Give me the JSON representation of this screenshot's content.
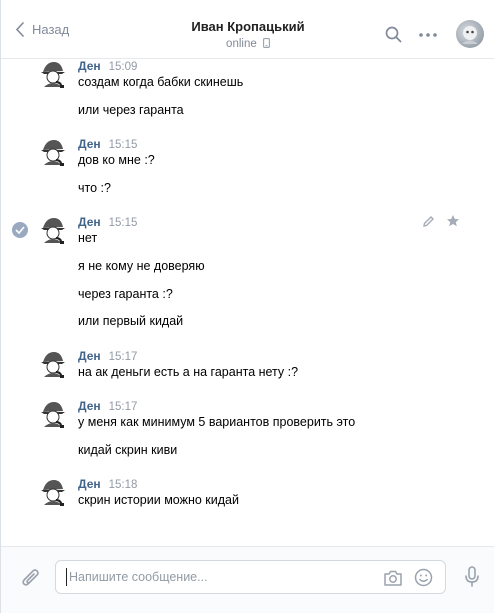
{
  "header": {
    "back_label": "Назад",
    "contact_name": "Иван Кропацький",
    "status": "online"
  },
  "messages": [
    {
      "author": "Ден",
      "time": "15:09",
      "lines": [
        "создам когда бабки скинешь",
        "или через гаранта"
      ]
    },
    {
      "author": "Ден",
      "time": "15:15",
      "lines": [
        "дов ко мне :?",
        "что :?"
      ]
    },
    {
      "author": "Ден",
      "time": "15:15",
      "lines": [
        "нет",
        "я не кому не доверяю",
        "через гаранта :?",
        "или первый кидай"
      ]
    },
    {
      "author": "Ден",
      "time": "15:17",
      "lines": [
        "на ак деньги есть а на гаранта нету :?"
      ]
    },
    {
      "author": "Ден",
      "time": "15:17",
      "lines": [
        "у меня как минимум 5 вариантов проверить это",
        "кидай скрин киви"
      ]
    },
    {
      "author": "Ден",
      "time": "15:18",
      "lines": [
        "скрин истории можно кидай"
      ]
    }
  ],
  "composer": {
    "placeholder": "Напишите сообщение..."
  }
}
